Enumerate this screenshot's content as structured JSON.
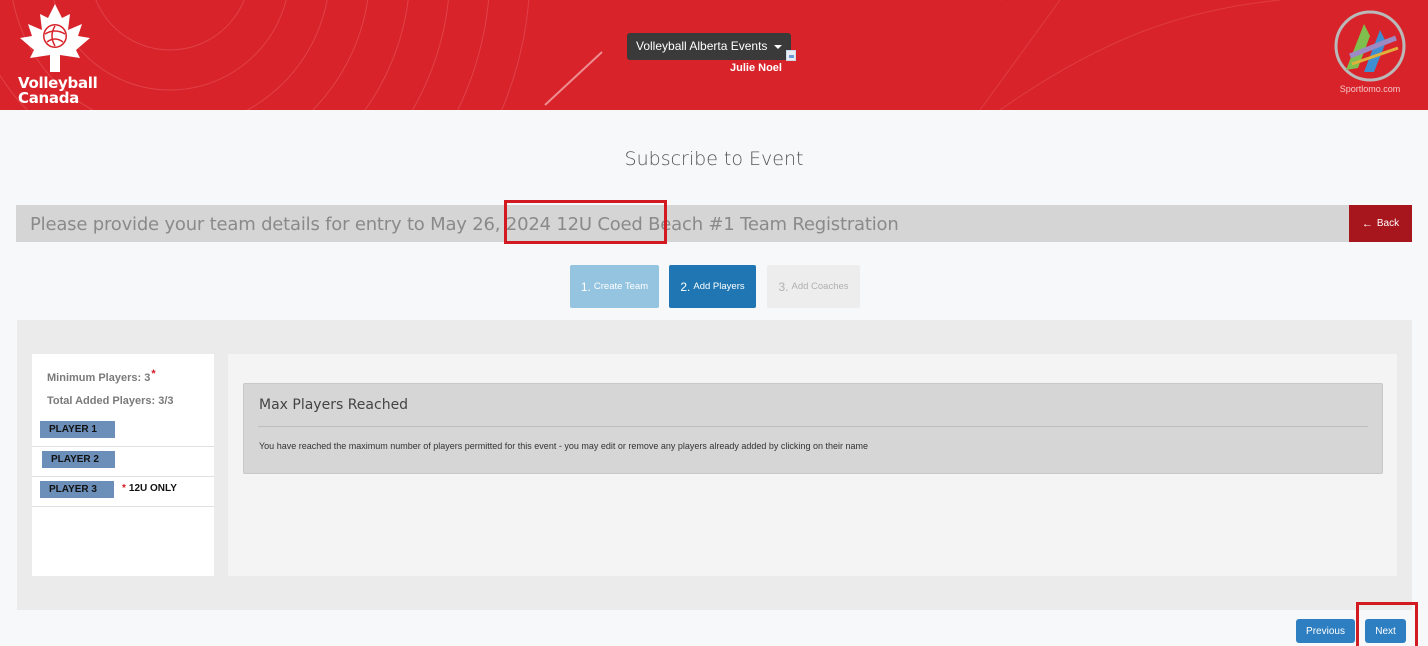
{
  "header": {
    "brand_line1": "Volleyball",
    "brand_line2": "Canada",
    "events_menu_label": "Volleyball Alberta Events",
    "user_name": "Julie Noel",
    "sportlomo_text": "Sportlomo.com"
  },
  "page": {
    "title": "Subscribe to Event",
    "banner_text": "Please provide your team details for entry to May 26, 2024 12U Coed Beach #1 Team Registration",
    "back_label": "Back"
  },
  "steps": [
    {
      "num": "1.",
      "label": "Create Team"
    },
    {
      "num": "2.",
      "label": "Add Players"
    },
    {
      "num": "3.",
      "label": "Add Coaches"
    }
  ],
  "players": {
    "minimum_label": "Minimum Players: 3",
    "required_mark": "*",
    "total_label": "Total Added Players: 3/3",
    "list": [
      {
        "label": "PLAYER 1",
        "note": ""
      },
      {
        "label": "PLAYER 2",
        "note": ""
      },
      {
        "label": "PLAYER 3",
        "note_star": "*",
        "note": "12U ONLY"
      }
    ]
  },
  "alert": {
    "title": "Max Players Reached",
    "message": "You have reached the maximum number of players permitted for this event - you may edit or remove any players already added by clicking on their name"
  },
  "footer": {
    "previous_label": "Previous",
    "next_label": "Next"
  },
  "colors": {
    "header_red": "#d8232a",
    "back_red": "#a8161d",
    "step_active": "#1f76b2",
    "step_done": "#94c4e0",
    "player_button": "#6c8fba",
    "highlight_red": "#d11a22"
  }
}
